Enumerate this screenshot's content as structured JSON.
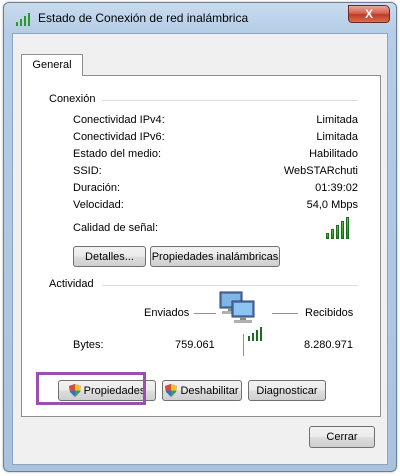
{
  "window": {
    "title": "Estado de Conexión de red inalámbrica",
    "close_label": "X"
  },
  "tabs": [
    {
      "label": "General"
    }
  ],
  "connection": {
    "section_label": "Conexión",
    "rows": [
      {
        "label": "Conectividad IPv4:",
        "value": "Limitada"
      },
      {
        "label": "Conectividad IPv6:",
        "value": "Limitada"
      },
      {
        "label": "Estado del medio:",
        "value": "Habilitado"
      },
      {
        "label": "SSID:",
        "value": "WebSTARchuti"
      },
      {
        "label": "Duración:",
        "value": "01:39:02"
      },
      {
        "label": "Velocidad:",
        "value": "54,0 Mbps"
      }
    ],
    "signal_label": "Calidad de señal:",
    "signal_level": "5/5",
    "details_button": "Detalles...",
    "wireless_props_button": "Propiedades inalámbricas"
  },
  "activity": {
    "section_label": "Actividad",
    "sent_label": "Enviados",
    "received_label": "Recibidos",
    "bytes_label": "Bytes:",
    "bytes_sent": "759.061",
    "bytes_received": "8.280.971"
  },
  "actions": {
    "properties_button": "Propiedades",
    "disable_button": "Deshabilitar",
    "diagnose_button": "Diagnosticar"
  },
  "footer": {
    "close_button": "Cerrar"
  },
  "colors": {
    "highlight": "#9b4fb0",
    "signal": "#2a9b2a",
    "shield_blue": "#3a6fc4",
    "shield_yellow": "#f2c230"
  }
}
